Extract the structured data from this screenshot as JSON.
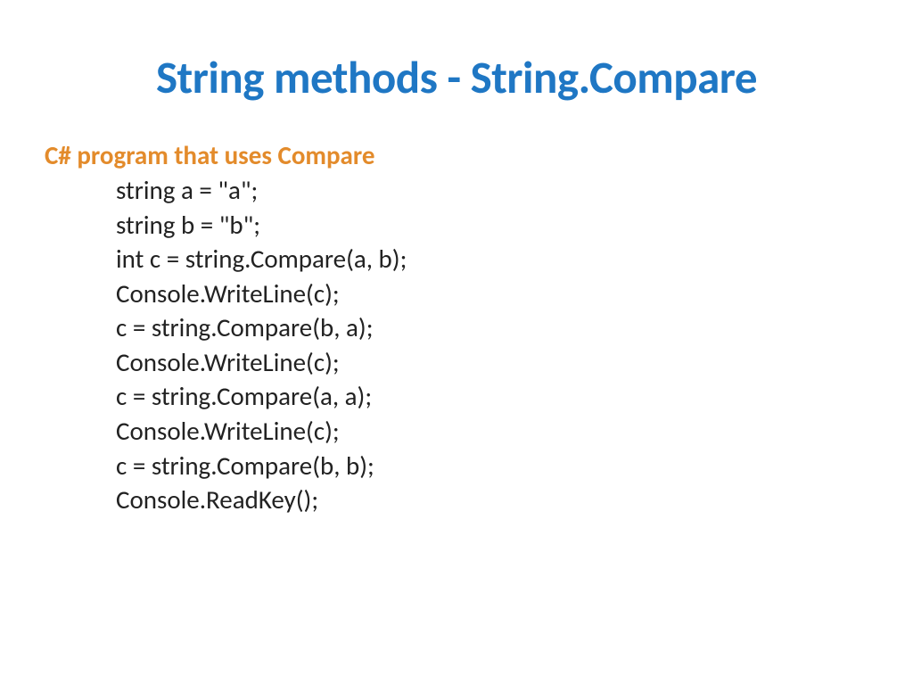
{
  "title": "String methods - String.Compare",
  "subtitle": "C# program that uses Compare",
  "code": {
    "l1": "string a = \"a\";",
    "l2": "string b = \"b\";",
    "l3": "int c = string.Compare(a, b);",
    "l4": "Console.WriteLine(c);",
    "l5": "c = string.Compare(b, a);",
    "l6": "Console.WriteLine(c);",
    "l7": "c = string.Compare(a, a);",
    "l8": "Console.WriteLine(c);",
    "l9": "c = string.Compare(b, b);",
    "l10": "Console.ReadKey();"
  }
}
